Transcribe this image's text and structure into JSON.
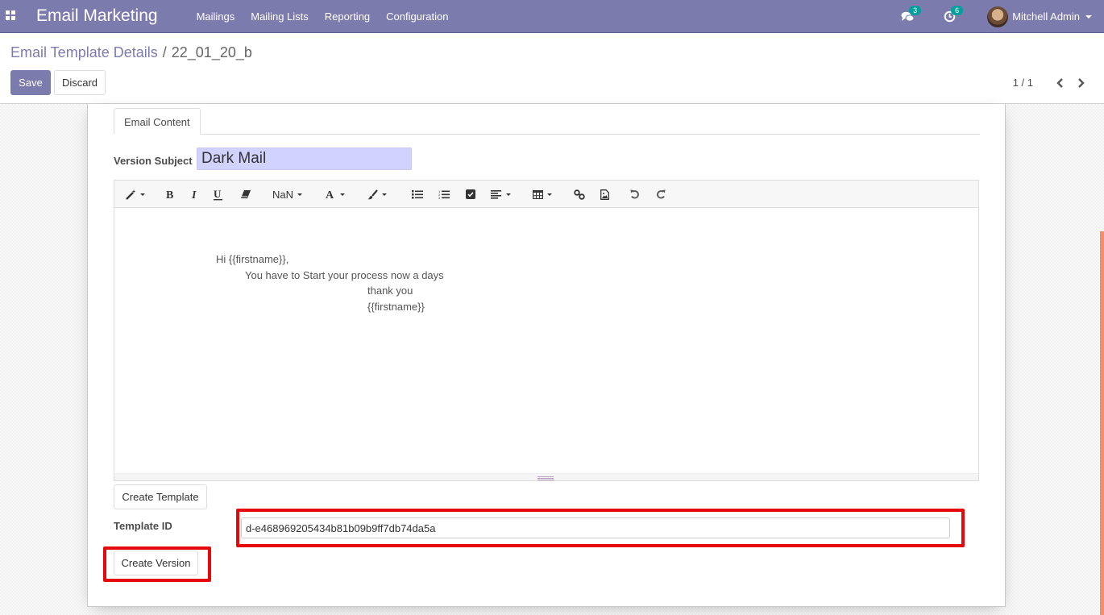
{
  "navbar": {
    "apps_icon": "grid-apps-icon",
    "brand": "Email Marketing",
    "menu": [
      "Mailings",
      "Mailing Lists",
      "Reporting",
      "Configuration"
    ],
    "messages_badge": "3",
    "activities_badge": "6",
    "user_name": "Mitchell Admin"
  },
  "control_panel": {
    "breadcrumb_parent": "Email Template Details",
    "breadcrumb_separator": "/",
    "breadcrumb_current": "22_01_20_b",
    "save_label": "Save",
    "discard_label": "Discard",
    "pager_value": "1 / 1"
  },
  "form": {
    "tab_label": "Email Content",
    "version_subject_label": "Version Subject",
    "version_subject_value": "Dark Mail",
    "toolbar": {
      "font_size_label": "NaN",
      "items": [
        "style",
        "bold",
        "italic",
        "underline",
        "eraser",
        "font-size",
        "font-color",
        "background-color",
        "unordered-list",
        "ordered-list",
        "checklist",
        "paragraph-align",
        "table",
        "link",
        "picture",
        "undo",
        "redo"
      ]
    },
    "body_lines": [
      "Hi {{firstname}},",
      "You have to Start your process now a days",
      "thank you",
      "{{firstname}}"
    ],
    "create_template_label": "Create Template",
    "template_id_label": "Template ID",
    "template_id_value": "d-e468969205434b81b09b9ff7db74da5a",
    "create_version_label": "Create Version"
  },
  "colors": {
    "brand": "#7c7bad",
    "badge": "#00a09d",
    "highlight": "#e5090b",
    "subject_bg": "#d2d2ff",
    "scroll_thumb": "#f0906b"
  }
}
